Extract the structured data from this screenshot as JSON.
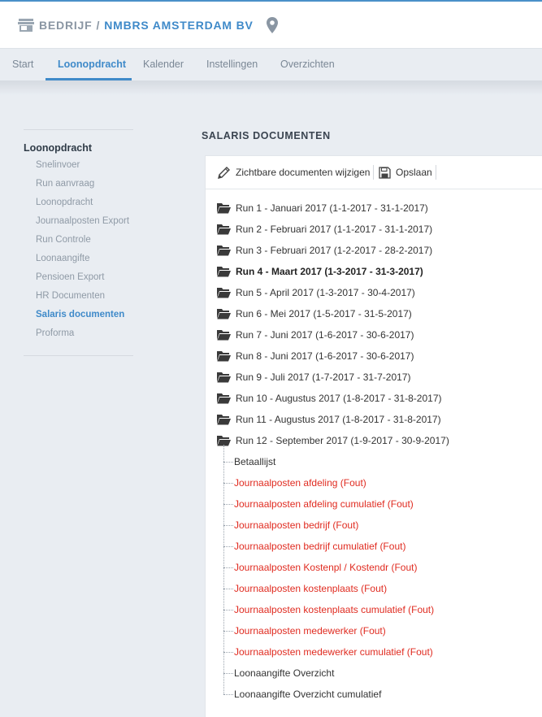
{
  "header": {
    "section": "BEDRIJF",
    "separator": "/",
    "company": "NMBRS AMSTERDAM BV",
    "icons": {
      "left": "store-icon",
      "right": "location-pin-icon"
    },
    "accent_color": "#3f8ac9",
    "muted_color": "#8a96a3"
  },
  "tabs": [
    {
      "label": "Start",
      "active": false
    },
    {
      "label": "Loonopdracht",
      "active": true
    },
    {
      "label": "Kalender",
      "active": false
    },
    {
      "label": "Instellingen",
      "active": false
    },
    {
      "label": "Overzichten",
      "active": false
    }
  ],
  "sidebar": {
    "title": "Loonopdracht",
    "items": [
      {
        "label": "Snelinvoer",
        "active": false
      },
      {
        "label": "Run aanvraag",
        "active": false
      },
      {
        "label": "Loonopdracht",
        "active": false
      },
      {
        "label": "Journaalposten Export",
        "active": false
      },
      {
        "label": "Run Controle",
        "active": false
      },
      {
        "label": "Loonaangifte",
        "active": false
      },
      {
        "label": "Pensioen Export",
        "active": false
      },
      {
        "label": "HR Documenten",
        "active": false
      },
      {
        "label": "Salaris documenten",
        "active": true
      },
      {
        "label": "Proforma",
        "active": false
      }
    ]
  },
  "main": {
    "title": "SALARIS DOCUMENTEN",
    "toolbar": {
      "edit_label": "Zichtbare documenten wijzigen",
      "edit_icon": "pencil-icon",
      "save_label": "Opslaan",
      "save_icon": "floppy-disk-icon"
    },
    "runs": [
      {
        "label": "Run 1 - Januari 2017 (1-1-2017 - 31-1-2017)",
        "bold": false,
        "expanded": false
      },
      {
        "label": "Run 2 - Februari 2017 (1-1-2017 - 31-1-2017)",
        "bold": false,
        "expanded": false
      },
      {
        "label": "Run 3 - Februari 2017 (1-2-2017 - 28-2-2017)",
        "bold": false,
        "expanded": false
      },
      {
        "label": "Run 4 - Maart 2017 (1-3-2017 - 31-3-2017)",
        "bold": true,
        "expanded": false
      },
      {
        "label": "Run 5 - April 2017 (1-3-2017 - 30-4-2017)",
        "bold": false,
        "expanded": false
      },
      {
        "label": "Run 6 - Mei 2017 (1-5-2017 - 31-5-2017)",
        "bold": false,
        "expanded": false
      },
      {
        "label": "Run 7 - Juni 2017 (1-6-2017 - 30-6-2017)",
        "bold": false,
        "expanded": false
      },
      {
        "label": "Run 8 - Juni 2017 (1-6-2017 - 30-6-2017)",
        "bold": false,
        "expanded": false
      },
      {
        "label": "Run 9 - Juli 2017 (1-7-2017 - 31-7-2017)",
        "bold": false,
        "expanded": false
      },
      {
        "label": "Run 10 - Augustus 2017 (1-8-2017 - 31-8-2017)",
        "bold": false,
        "expanded": false
      },
      {
        "label": "Run 11 - Augustus 2017 (1-8-2017 - 31-8-2017)",
        "bold": false,
        "expanded": false
      },
      {
        "label": "Run 12 - September 2017 (1-9-2017 - 30-9-2017)",
        "bold": false,
        "expanded": true
      }
    ],
    "documents": [
      {
        "label": "Betaallijst",
        "error": false
      },
      {
        "label": "Journaalposten afdeling (Fout)",
        "error": true
      },
      {
        "label": "Journaalposten afdeling cumulatief (Fout)",
        "error": true
      },
      {
        "label": "Journaalposten bedrijf (Fout)",
        "error": true
      },
      {
        "label": "Journaalposten bedrijf cumulatief (Fout)",
        "error": true
      },
      {
        "label": "Journaalposten Kostenpl / Kostendr (Fout)",
        "error": true
      },
      {
        "label": "Journaalposten kostenplaats (Fout)",
        "error": true
      },
      {
        "label": "Journaalposten kostenplaats cumulatief (Fout)",
        "error": true
      },
      {
        "label": "Journaalposten medewerker (Fout)",
        "error": true
      },
      {
        "label": "Journaalposten medewerker cumulatief (Fout)",
        "error": true
      },
      {
        "label": "Loonaangifte Overzicht",
        "error": false
      },
      {
        "label": "Loonaangifte Overzicht cumulatief",
        "error": false
      }
    ],
    "error_color": "#e02b20",
    "folder_icon": "folder-icon"
  }
}
